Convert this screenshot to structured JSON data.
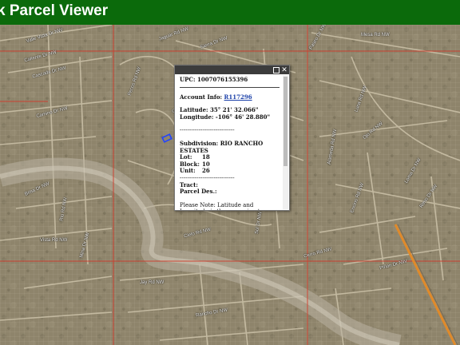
{
  "header": {
    "title": "k Parcel Viewer",
    "background": "#0b6a0b"
  },
  "map": {
    "parcel_boundary_color": "#d23a2a",
    "selected_parcel_color": "#2244ff",
    "streets": [
      "Valle Vista Dr NW",
      "Caliente Dr NW",
      "Cascada Dr NW",
      "Camino Dr NW",
      "Jaguar Rd NW",
      "Sierra Dr NW",
      "Pecos Rd NW",
      "Ocotillo Rd NW",
      "Paseo Dr NW",
      "Mesa Rd NW",
      "Luna Rd NW",
      "Ojo Rd NW",
      "Alameda Rd NW",
      "Encino Rd NW",
      "Loma Dr NW",
      "Reno Dr NW",
      "Brisa Dr NW",
      "Rio Rd NW",
      "Vista Rd NW",
      "Mina Dr NW",
      "Cielo Rd NW",
      "Sol Dr NW",
      "Jay Rd NW",
      "Rancho Dr NW",
      "Cerro Rd NW",
      "Piñon Dr NW"
    ]
  },
  "popup": {
    "upc": "UPC: 1007076155396",
    "account_label": "Account Info:",
    "account_link": "R117296",
    "latitude": "Latitude: 35° 21' 32.066\"",
    "longitude": "Longitude: -106° 46' 28.880\"",
    "divider": "-----------------------------",
    "subdivision": "Subdivision: RIO RANCHO ESTATES",
    "lot_label": "Lot:",
    "lot_value": "18",
    "block_label": "Block:",
    "block_value": "10",
    "unit_label": "Unit:",
    "unit_value": "26",
    "tract_label": "Tract:",
    "parcel_des_label": "Parcel Des.:",
    "note": "Please Note: Latitude and Longitude is the approximate center of the parcel shown."
  }
}
